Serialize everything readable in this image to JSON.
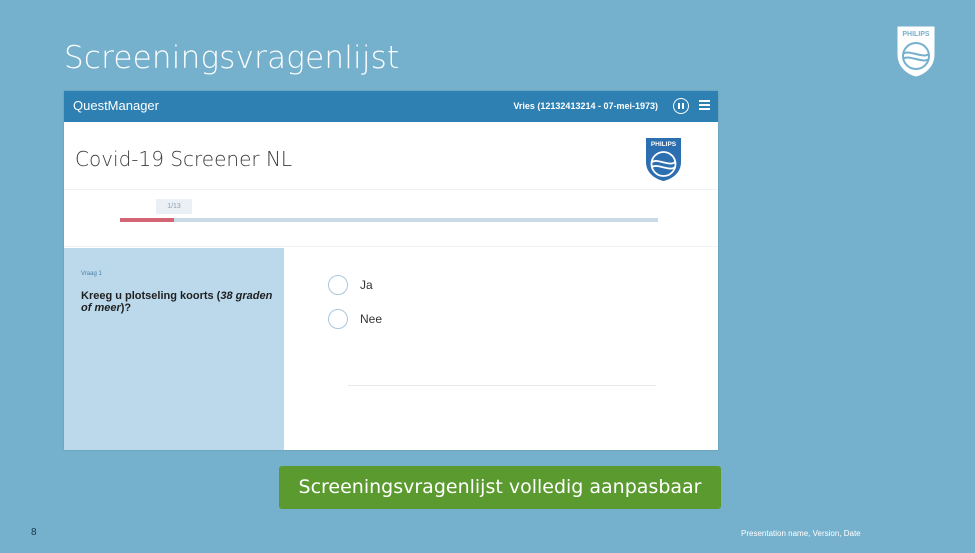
{
  "slide": {
    "title": "Screeningsvragenlijst",
    "brand": "PHILIPS",
    "cta": "Screeningsvragenlijst volledig aanpasbaar",
    "page_number": "8",
    "footer": "Presentation name, Version, Date"
  },
  "app": {
    "name": "QuestManager",
    "patient_info": "Vries (12132413214 - 07-mei-1973)",
    "questionnaire_title": "Covid-19 Screener NL",
    "brand": "PHILIPS",
    "progress": {
      "label": "1/13",
      "fraction": 0.1
    },
    "question": {
      "number_label": "Vraag 1",
      "text_prefix": "Kreeg u plotseling koorts (",
      "text_emphasis": "38 graden of meer",
      "text_suffix": ")?"
    },
    "answers": [
      {
        "label": "Ja"
      },
      {
        "label": "Nee"
      }
    ]
  },
  "colors": {
    "slide_background": "#75b1cd",
    "topbar": "#2e7fb2",
    "progress_fill": "#d26474",
    "question_panel": "#bcd9ec",
    "cta": "#5a9a2f"
  }
}
